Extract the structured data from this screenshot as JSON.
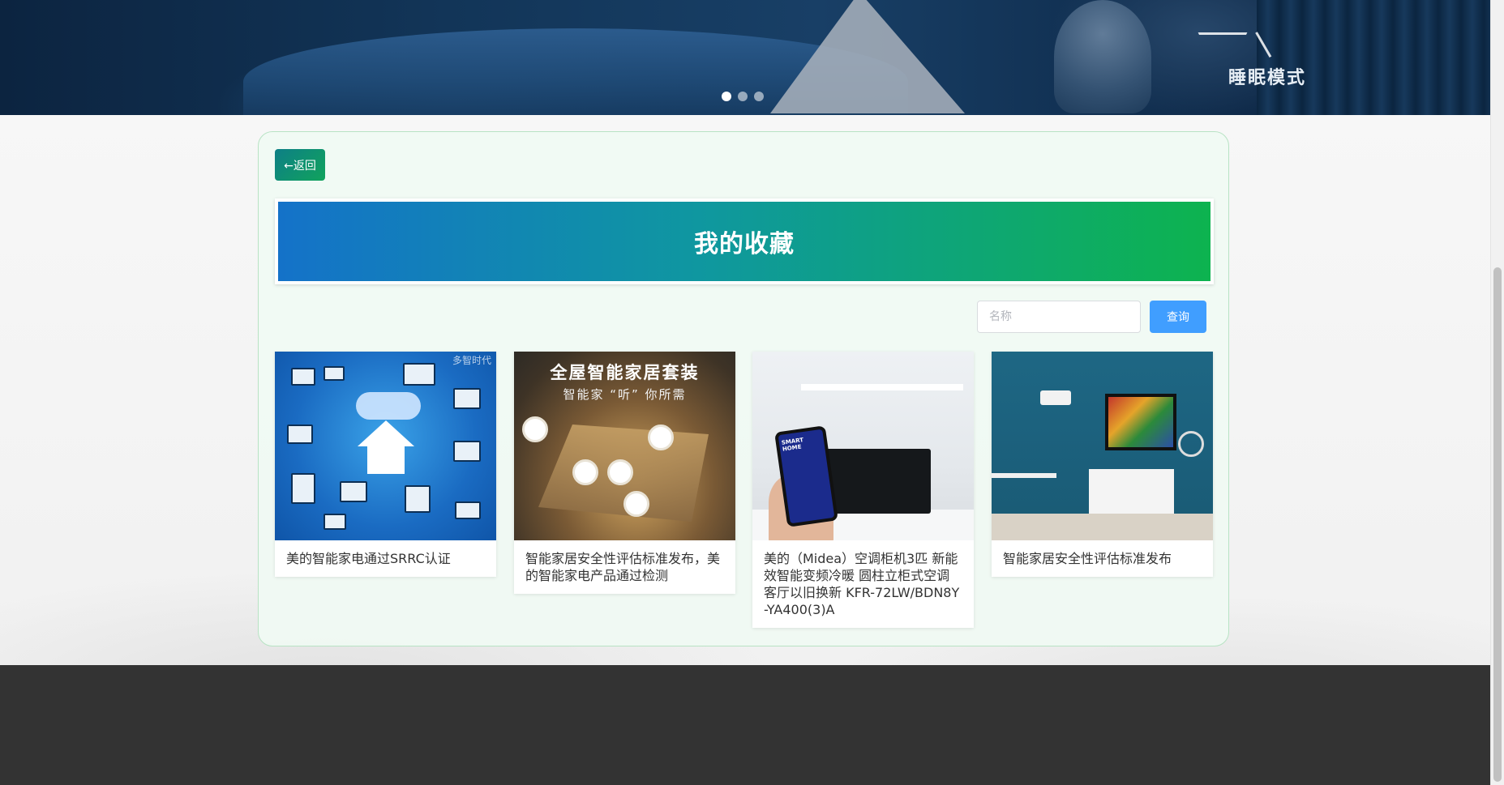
{
  "banner": {
    "mode_label": "睡眠模式",
    "carousel_dots": [
      {
        "active": true
      },
      {
        "active": false
      },
      {
        "active": false
      }
    ]
  },
  "panel": {
    "back_label": "←返回",
    "title": "我的收藏",
    "search": {
      "placeholder": "名称",
      "value": "",
      "button_label": "查询"
    },
    "favorites": [
      {
        "title": "美的智能家电通过SRRC认证",
        "image_watermark": "多智时代",
        "image_icon": "smart-home-network-image"
      },
      {
        "title": "智能家居安全性评估标准发布，美的智能家电产品通过检测",
        "image_heading": "全屋智能家居套装",
        "image_subheading": "智能家 “听” 你所需",
        "image_icon": "smart-home-kit-image"
      },
      {
        "title": "美的（Midea）空调柜机3匹 新能效智能变频冷暖 圆柱立柜式空调 客厅以旧换新 KFR-72LW/BDN8Y-YA400(3)A",
        "image_phone_label": "SMART HOME",
        "image_icon": "smart-phone-living-room-image"
      },
      {
        "title": "智能家居安全性评估标准发布",
        "image_icon": "teal-living-room-image"
      }
    ]
  },
  "colors": {
    "back_button": "#0f8f74",
    "title_gradient_start": "#1472c9",
    "title_gradient_end": "#0db34f",
    "search_button": "#409eff",
    "footer": "#333333"
  }
}
